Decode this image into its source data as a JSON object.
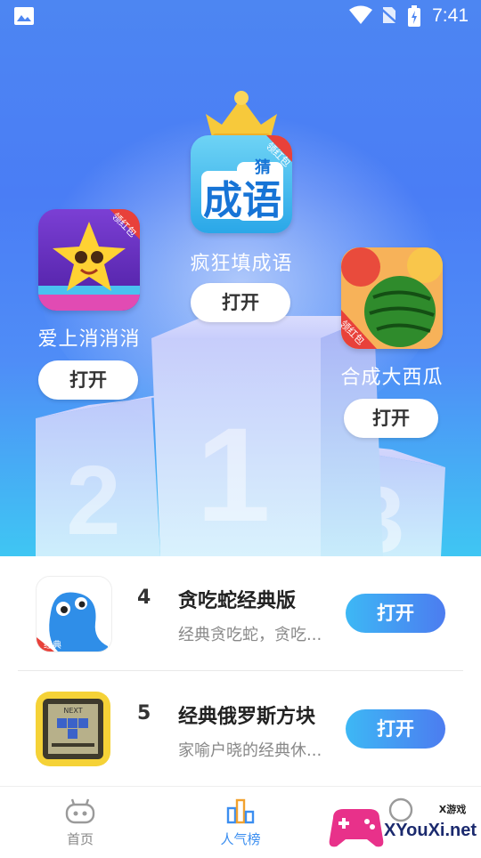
{
  "status": {
    "time": "7:41"
  },
  "podium": {
    "first": {
      "rank": "1",
      "name": "疯狂填成语",
      "button": "打开",
      "icon_text": "成语",
      "icon_badge": "领红包",
      "icon_mini": "猜"
    },
    "second": {
      "rank": "2",
      "name": "爱上消消消",
      "button": "打开",
      "icon_badge": "领红包"
    },
    "third": {
      "rank": "3",
      "name": "合成大西瓜",
      "button": "打开",
      "icon_badge": "领红包"
    }
  },
  "list": [
    {
      "rank": "4",
      "title": "贪吃蛇经典版",
      "desc": "经典贪吃蛇，贪吃...",
      "button": "打开",
      "icon_badge": "经典"
    },
    {
      "rank": "5",
      "title": "经典俄罗斯方块",
      "desc": "家喻户晓的经典休...",
      "button": "打开",
      "icon_badge": "NEXT"
    }
  ],
  "nav": {
    "home": "首页",
    "popular": "人气榜"
  },
  "watermark": {
    "small": "X游戏",
    "big": "XYouXi.net"
  },
  "colors": {
    "accent": "#3b8ef0",
    "hero_top": "#4d86f2",
    "hero_bottom": "#3fc6f3"
  }
}
